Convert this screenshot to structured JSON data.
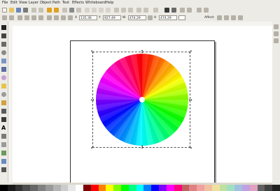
{
  "menubar": {
    "items": [
      "File",
      "Edit",
      "View",
      "Layer",
      "Object",
      "Path",
      "Text",
      "Effects",
      "Whiteboard",
      "Help"
    ]
  },
  "controls": {
    "x_value": "135.36",
    "y_value": "927.49",
    "w_value": "474.29",
    "h_value": "474.29",
    "affect_label": "Affect:"
  },
  "toolbox": {
    "tools": [
      "select-arrow-icon",
      "node-edit-icon",
      "tweak-icon",
      "zoom-icon",
      "rectangle-icon",
      "3d-box-icon",
      "ellipse-icon",
      "star-icon",
      "spiral-icon",
      "pencil-icon",
      "pen-icon",
      "calligraphy-icon",
      "text-icon",
      "spray-icon",
      "eraser-icon",
      "bucket-fill-icon",
      "gradient-icon",
      "dropper-icon"
    ]
  },
  "palette": {
    "colors": [
      "#000000",
      "#1a1a1a",
      "#333333",
      "#4d4d4d",
      "#666666",
      "#808080",
      "#999999",
      "#b3b3b3",
      "#cccccc",
      "#e6e6e6",
      "#ffffff",
      "#800000",
      "#ff0000",
      "#ff8000",
      "#ffff00",
      "#80ff00",
      "#00ff00",
      "#00ff80",
      "#00ffff",
      "#0080ff",
      "#0000ff",
      "#8000ff",
      "#ff00ff",
      "#ff0080",
      "#c06060",
      "#e08080",
      "#f0a0a0",
      "#f0c0a0",
      "#f0e0a0",
      "#c0e0a0",
      "#a0e0c0",
      "#a0c0e0",
      "#c0a0e0",
      "#e0a0c0",
      "#606060",
      "#404040",
      "#202020"
    ]
  }
}
